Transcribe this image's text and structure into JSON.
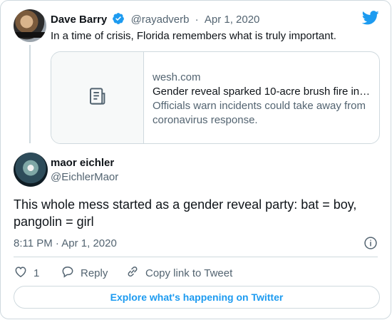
{
  "quoted_tweet": {
    "name": "Dave Barry",
    "handle": "@rayadverb",
    "separator": "·",
    "date": "Apr 1, 2020",
    "text": "In a time of crisis, Florida remembers what is truly important.",
    "link_card": {
      "domain": "wesh.com",
      "title": "Gender reveal sparked 10-acre brush fire in…",
      "description": "Officials warn incidents could take away from coronavirus response."
    }
  },
  "tweet": {
    "name": "maor eichler",
    "handle": "@EichlerMaor",
    "text": "This whole mess started as a gender reveal party: bat = boy, pangolin = girl",
    "timestamp": "8:11 PM · Apr 1, 2020"
  },
  "actions": {
    "like_count": "1",
    "reply_label": "Reply",
    "copy_link_label": "Copy link to Tweet"
  },
  "footer": {
    "explore_label": "Explore what's happening on Twitter"
  },
  "colors": {
    "accent": "#1d9bf0",
    "text": "#0f1419",
    "secondary": "#536471",
    "border": "#cfd9de"
  },
  "icons": [
    "verified-badge-icon",
    "twitter-logo-icon",
    "article-icon",
    "info-icon",
    "heart-icon",
    "reply-icon",
    "link-icon"
  ]
}
